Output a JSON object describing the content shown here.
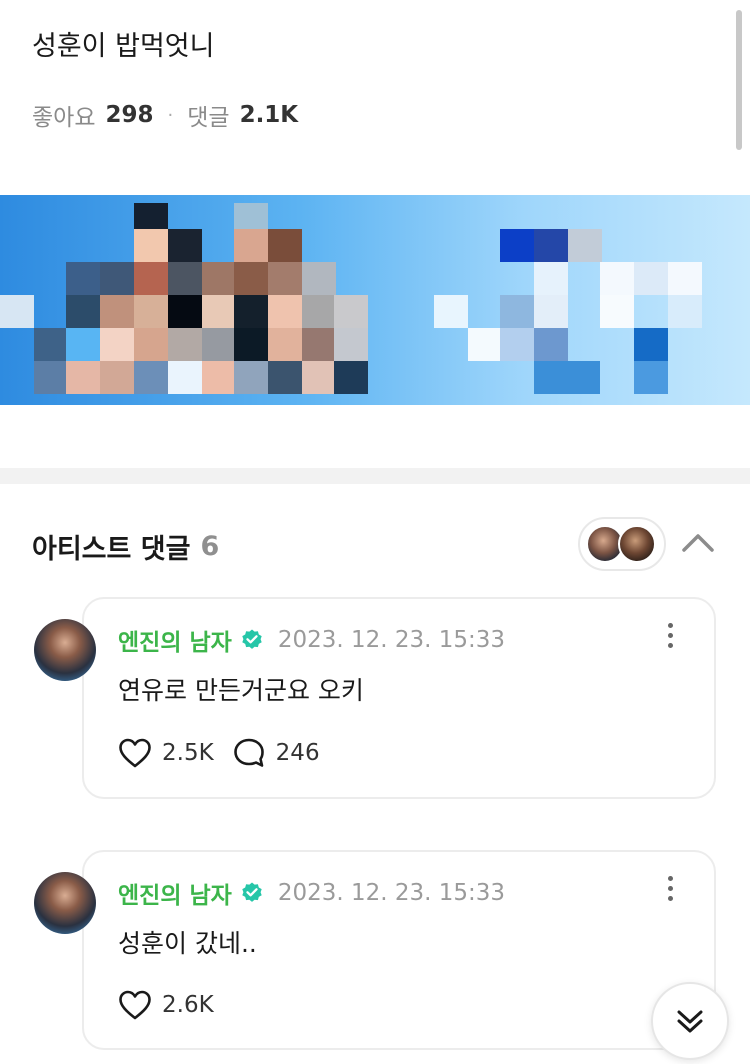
{
  "post": {
    "title": "성훈이 밥먹엇니",
    "likes_label": "좋아요",
    "likes_count": "298",
    "separator": "·",
    "comments_label": "댓글",
    "comments_count": "2.1K"
  },
  "artist_comments": {
    "title": "아티스트 댓글",
    "count": "6"
  },
  "comments": [
    {
      "author": "엔진의 남자",
      "date": "2023. 12. 23. 15:33",
      "text": "연유로 만든거군요 오키",
      "likes": "2.5K",
      "replies": "246"
    },
    {
      "author": "엔진의 남자",
      "date": "2023. 12. 23. 15:33",
      "text": "성훈이 갔네..",
      "likes": "2.6K"
    }
  ],
  "icons": {
    "verified": "verified-badge-icon",
    "more": "more-vertical-icon",
    "like": "heart-icon",
    "reply": "speech-bubble-icon",
    "collapse": "chevron-up-icon",
    "scroll_down": "double-chevron-down-icon"
  },
  "colors": {
    "author": "#3cb54a",
    "verified": "#26c6a8",
    "stat_text": "#8a8a8a"
  }
}
